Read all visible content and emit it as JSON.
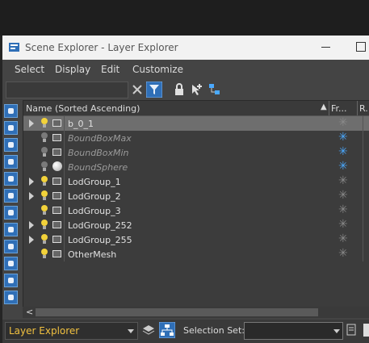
{
  "window": {
    "title": "Scene Explorer - Layer Explorer"
  },
  "menu": [
    "Select",
    "Display",
    "Edit",
    "Customize"
  ],
  "search": {
    "placeholder": ""
  },
  "columns": {
    "name": "Name (Sorted Ascending)",
    "freeze": "Fr...",
    "render": "R."
  },
  "rows": [
    {
      "name": "b_0_1",
      "expandable": true,
      "hidden": false,
      "frozen": false,
      "selected": true,
      "icon": "geometry-icon"
    },
    {
      "name": "BoundBoxMax",
      "expandable": false,
      "hidden": true,
      "frozen": true,
      "selected": false,
      "icon": "geometry-icon"
    },
    {
      "name": "BoundBoxMin",
      "expandable": false,
      "hidden": true,
      "frozen": true,
      "selected": false,
      "icon": "geometry-icon"
    },
    {
      "name": "BoundSphere",
      "expandable": false,
      "hidden": true,
      "frozen": true,
      "selected": false,
      "icon": "sphere-icon"
    },
    {
      "name": "LodGroup_1",
      "expandable": true,
      "hidden": false,
      "frozen": false,
      "selected": false,
      "icon": "geometry-icon"
    },
    {
      "name": "LodGroup_2",
      "expandable": true,
      "hidden": false,
      "frozen": false,
      "selected": false,
      "icon": "geometry-icon"
    },
    {
      "name": "LodGroup_3",
      "expandable": false,
      "hidden": false,
      "frozen": false,
      "selected": false,
      "icon": "geometry-icon"
    },
    {
      "name": "LodGroup_252",
      "expandable": true,
      "hidden": false,
      "frozen": false,
      "selected": false,
      "icon": "geometry-icon"
    },
    {
      "name": "LodGroup_255",
      "expandable": true,
      "hidden": false,
      "frozen": false,
      "selected": false,
      "icon": "geometry-icon"
    },
    {
      "name": "OtherMesh",
      "expandable": false,
      "hidden": false,
      "frozen": false,
      "selected": false,
      "icon": "geometry-icon"
    }
  ],
  "bottom": {
    "explorer": "Layer Explorer",
    "selection_set_label": "Selection Set:",
    "selection_set_value": ""
  },
  "colors": {
    "accent": "#2f6fb7",
    "frozen_blue": "#4aa9ff",
    "layer_text": "#f0c040"
  }
}
